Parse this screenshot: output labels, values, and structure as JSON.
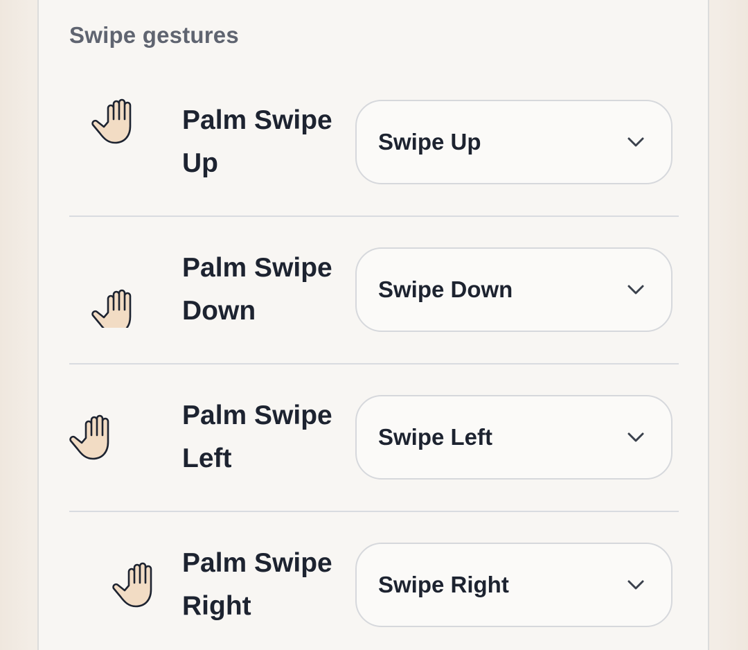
{
  "section": {
    "title": "Swipe gestures"
  },
  "gestures": [
    {
      "label": "Palm Swipe Up",
      "selected": "Swipe Up",
      "icon": "palm-swipe-up-icon"
    },
    {
      "label": "Palm Swipe Down",
      "selected": "Swipe Down",
      "icon": "palm-swipe-down-icon"
    },
    {
      "label": "Palm Swipe Left",
      "selected": "Swipe Left",
      "icon": "palm-swipe-left-icon"
    },
    {
      "label": "Palm Swipe Right",
      "selected": "Swipe Right",
      "icon": "palm-swipe-right-icon"
    }
  ],
  "colors": {
    "panel_bg": "#f8f6f3",
    "text_primary": "#1d2330",
    "text_secondary": "#5f6470",
    "border": "#d6d8dc",
    "hand_fill": "#f2dcc4"
  }
}
